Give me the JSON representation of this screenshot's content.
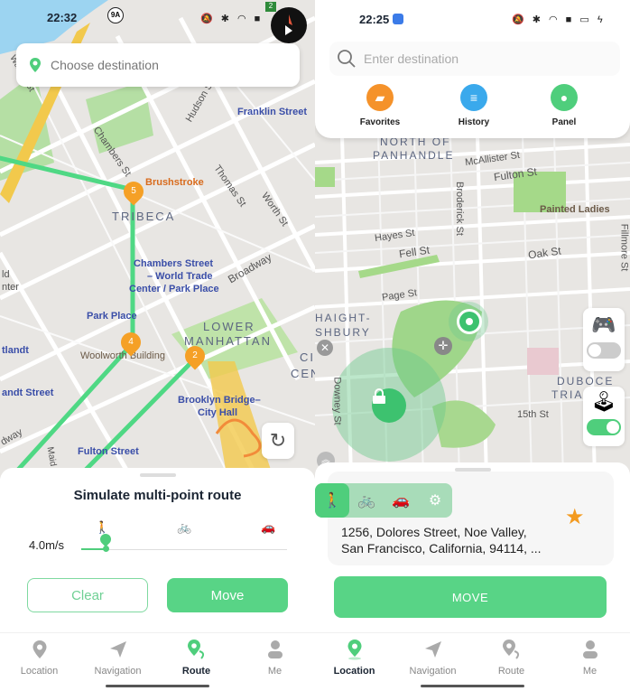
{
  "left": {
    "status": {
      "time": "22:32",
      "road_badge": "9A",
      "route_badge": "2"
    },
    "destination": {
      "placeholder": "Choose destination"
    },
    "map_labels": {
      "warren": "Warren St",
      "chambers": "Chambers St",
      "hudson": "Hudson St",
      "franklin": "Franklin Street",
      "brushstroke": "Brushstroke",
      "thomas": "Thomas St",
      "worth": "Worth St",
      "tribeca": "TRIBECA",
      "chambers_station": "Chambers Street",
      "wtc": "– World Trade",
      "wtc2": "Center / Park Place",
      "broadway": "Broadway",
      "park_place": "Park Place",
      "lower": "LOWER",
      "manhattan": "MANHATTAN",
      "woolworth": "Woolworth Building",
      "brooklyn": "Brooklyn Bridge–",
      "city_hall": "City Hall",
      "cortlandt": "tlandt",
      "cortlandt_street": "andt Street",
      "fulton": "Fulton Street",
      "maiden": "Maid",
      "civic": "CI",
      "civic2": "CEN",
      "broadway_low": "dway",
      "world": "ld",
      "center": "nter"
    },
    "waypoints": [
      "5",
      "4",
      "2"
    ],
    "sheet": {
      "title": "Simulate multi-point route",
      "speed": "4.0m/s",
      "speed_fraction": 0.12,
      "modes": [
        "walk",
        "bike",
        "car"
      ],
      "clear_label": "Clear",
      "move_label": "Move"
    },
    "tabs": [
      {
        "label": "Location",
        "icon": "location-pin-icon",
        "active": false
      },
      {
        "label": "Navigation",
        "icon": "paper-plane-icon",
        "active": false
      },
      {
        "label": "Route",
        "icon": "route-pin-icon",
        "active": true
      },
      {
        "label": "Me",
        "icon": "person-icon",
        "active": false
      }
    ]
  },
  "right": {
    "status": {
      "time": "22:25"
    },
    "search": {
      "placeholder": "Enter destination"
    },
    "quick_actions": [
      {
        "label": "Favorites",
        "icon": "folder-star-icon",
        "color": "#f5922a"
      },
      {
        "label": "History",
        "icon": "document-icon",
        "color": "#3aa9ec"
      },
      {
        "label": "Panel",
        "icon": "location-pin-icon",
        "color": "#4fce7c"
      }
    ],
    "map_labels": {
      "north": "NORTH OF",
      "panhandle": "PANHANDLE",
      "mcallister": "McAllister St",
      "fulton": "Fulton St",
      "broderick": "Broderick St",
      "painted": "Painted Ladies",
      "hayes": "Hayes St",
      "fell": "Fell St",
      "oak": "Oak St",
      "fillmore": "Fillmore St",
      "page": "Page St",
      "haight": "HAIGHT-",
      "ashbury": "SHBURY",
      "downey": "Downey St",
      "duboce": "DUBOCE",
      "triangle": "TRIAN",
      "fifteenth": "15th St"
    },
    "joystick_toggle_off": false,
    "joystick_toggle_on": true,
    "address": {
      "line1": "1256, Dolores Street, Noe Valley,",
      "line2": "San Francisco, California, 94114, ..."
    },
    "modes": [
      "walk",
      "bike",
      "car",
      "settings"
    ],
    "move_label": "MOVE",
    "tabs": [
      {
        "label": "Location",
        "icon": "location-pin-icon",
        "active": true
      },
      {
        "label": "Navigation",
        "icon": "paper-plane-icon",
        "active": false
      },
      {
        "label": "Route",
        "icon": "route-pin-icon",
        "active": false
      },
      {
        "label": "Me",
        "icon": "person-icon",
        "active": false
      }
    ]
  },
  "colors": {
    "accent": "#58d486",
    "waypoint": "#f5a026",
    "route": "#4fd884"
  }
}
